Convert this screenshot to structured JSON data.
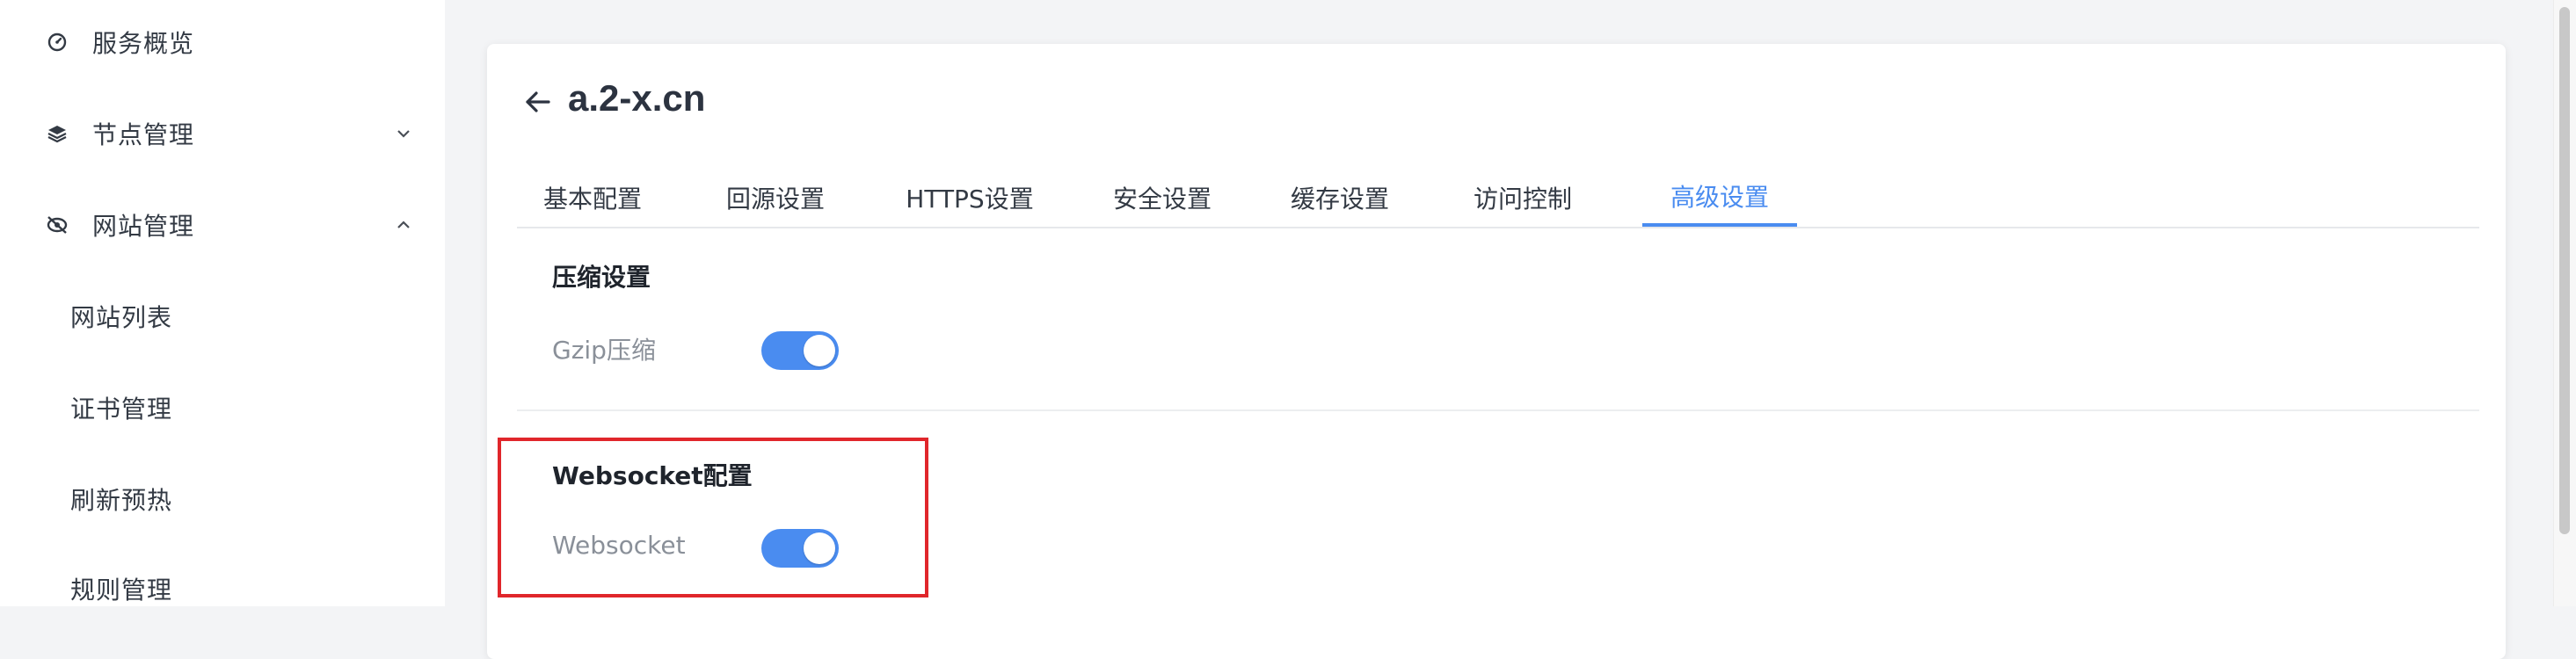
{
  "sidebar": {
    "items": [
      {
        "label": "服务概览",
        "icon": "dashboard-icon"
      },
      {
        "label": "节点管理",
        "icon": "layers-icon",
        "chevron": "down"
      },
      {
        "label": "网站管理",
        "icon": "eye-slash-icon",
        "chevron": "up"
      }
    ],
    "sub_items": [
      {
        "label": "网站列表"
      },
      {
        "label": "证书管理"
      },
      {
        "label": "刷新预热"
      },
      {
        "label": "规则管理"
      }
    ]
  },
  "header": {
    "domain": "a.2-x.cn"
  },
  "tabs": [
    {
      "label": "基本配置"
    },
    {
      "label": "回源设置"
    },
    {
      "label": "HTTPS设置"
    },
    {
      "label": "安全设置"
    },
    {
      "label": "缓存设置"
    },
    {
      "label": "访问控制"
    },
    {
      "label": "高级设置",
      "active": true
    }
  ],
  "sections": {
    "compression": {
      "title": "压缩设置",
      "field_label": "Gzip压缩",
      "enabled": true
    },
    "websocket": {
      "title": "Websocket配置",
      "field_label": "Websocket",
      "enabled": true
    }
  },
  "colors": {
    "accent": "#4a8cf0",
    "highlight": "#e0262b"
  }
}
